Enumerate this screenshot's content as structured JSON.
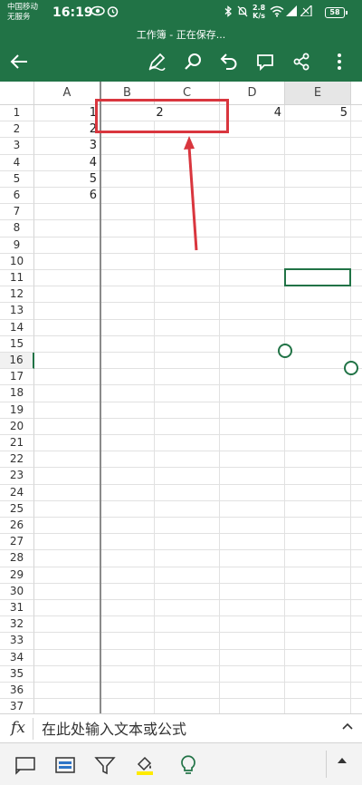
{
  "status_bar": {
    "carrier_line1": "中国移动",
    "carrier_line2": "无服务",
    "time": "16:19",
    "network_speed_top": "2.8",
    "network_speed_unit": "K/s",
    "battery": "58"
  },
  "title_bar": {
    "title": "工作簿 - 正在保存..."
  },
  "toolbar": {
    "icons": [
      "back-arrow-icon",
      "pen-draw-icon",
      "search-icon",
      "undo-icon",
      "comment-icon",
      "share-icon",
      "more-vertical-icon"
    ]
  },
  "sheet": {
    "columns": [
      "A",
      "B",
      "C",
      "D",
      "E"
    ],
    "selected_column": "E",
    "rows": [
      "1",
      "2",
      "3",
      "4",
      "5",
      "6",
      "7",
      "8",
      "9",
      "10",
      "11",
      "12",
      "13",
      "14",
      "15",
      "16",
      "17",
      "18",
      "19",
      "20",
      "21",
      "22",
      "23",
      "24",
      "25",
      "26",
      "27",
      "28",
      "29",
      "30",
      "31",
      "32",
      "33",
      "34",
      "35",
      "36",
      "37"
    ],
    "selected_row": "16",
    "cells": {
      "A": [
        "1",
        "2",
        "3",
        "4",
        "5",
        "6"
      ],
      "BC1": "2",
      "D1": "4",
      "E1": "5"
    }
  },
  "formula_bar": {
    "fx_label": "fx",
    "placeholder": "在此处输入文本或公式"
  },
  "bottom_toolbar": {
    "icons": [
      "sheet-view-icon",
      "card-view-icon",
      "filter-icon",
      "fill-color-icon",
      "idea-bulb-icon",
      "expand-up-icon"
    ],
    "fill_color_accent": "#ffeb00"
  },
  "colors": {
    "header_green": "#217346",
    "annotation_red": "#d9363e"
  }
}
